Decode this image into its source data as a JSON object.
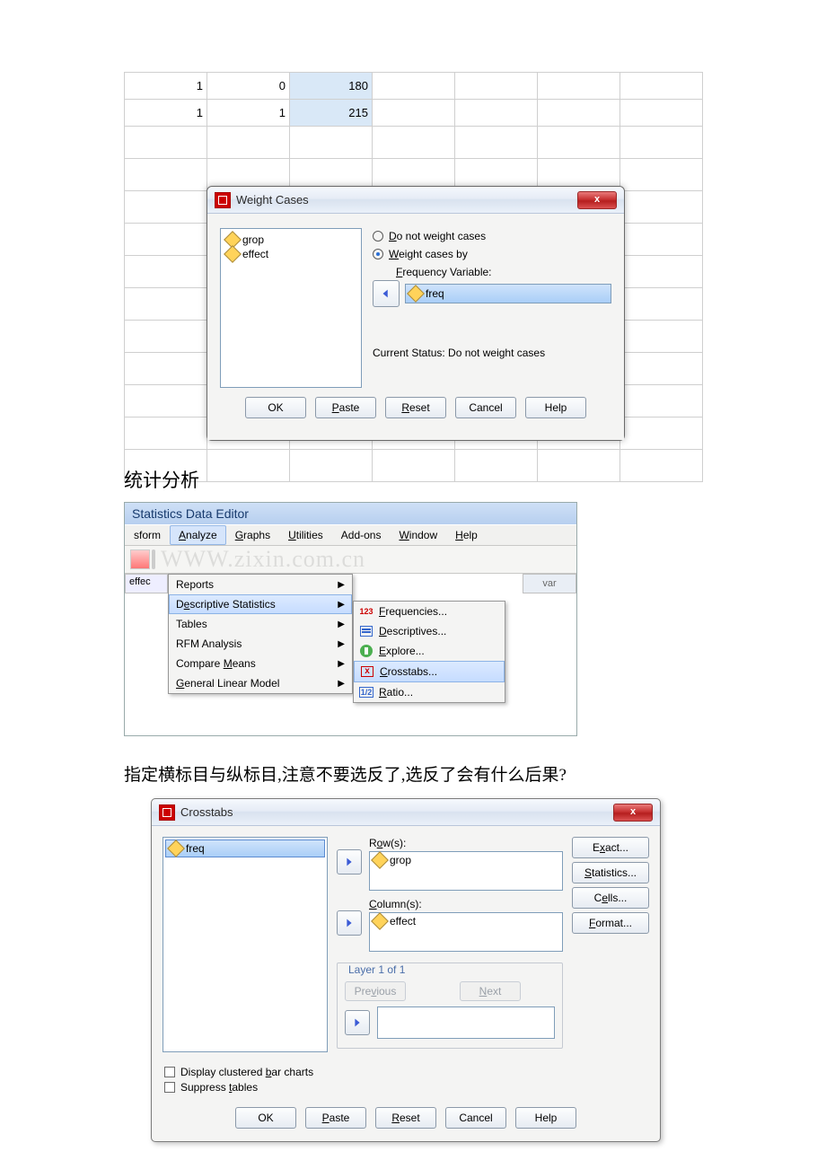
{
  "grid": {
    "rows": [
      {
        "c1": "1",
        "c2": "0",
        "c3": "180"
      },
      {
        "c1": "1",
        "c2": "1",
        "c3": "215"
      }
    ]
  },
  "weightcases": {
    "title": "Weight Cases",
    "vars": [
      "grop",
      "effect"
    ],
    "opt_no_weight": "Do not weight cases",
    "opt_weight_by": "Weight cases by",
    "freq_label": "Frequency Variable:",
    "freq_var": "freq",
    "status": "Current Status: Do not weight cases",
    "buttons": {
      "ok": "OK",
      "paste": "Paste",
      "reset": "Reset",
      "cancel": "Cancel",
      "help": "Help"
    }
  },
  "section1": "统计分析",
  "editor": {
    "title": "Statistics Data Editor",
    "menu": [
      "sform",
      "Analyze",
      "Graphs",
      "Utilities",
      "Add-ons",
      "Window",
      "Help"
    ],
    "column_left": "effec",
    "column_right": "var",
    "analyze_items": [
      "Reports",
      "Descriptive Statistics",
      "Tables",
      "RFM Analysis",
      "Compare Means",
      "General Linear Model"
    ],
    "desc_sub": [
      "Frequencies...",
      "Descriptives...",
      "Explore...",
      "Crosstabs...",
      "Ratio..."
    ],
    "watermark": "WWW.zixin.com.cn"
  },
  "section2": "指定横标目与纵标目,注意不要选反了,选反了会有什么后果?",
  "crosstabs": {
    "title": "Crosstabs",
    "var": "freq",
    "rows_label": "Row(s):",
    "rows_var": "grop",
    "cols_label": "Column(s):",
    "cols_var": "effect",
    "layer_label": "Layer 1 of 1",
    "prev": "Previous",
    "next": "Next",
    "chk1": "Display clustered bar charts",
    "chk2": "Suppress tables",
    "right_buttons": [
      "Exact...",
      "Statistics...",
      "Cells...",
      "Format..."
    ],
    "buttons": {
      "ok": "OK",
      "paste": "Paste",
      "reset": "Reset",
      "cancel": "Cancel",
      "help": "Help"
    }
  }
}
